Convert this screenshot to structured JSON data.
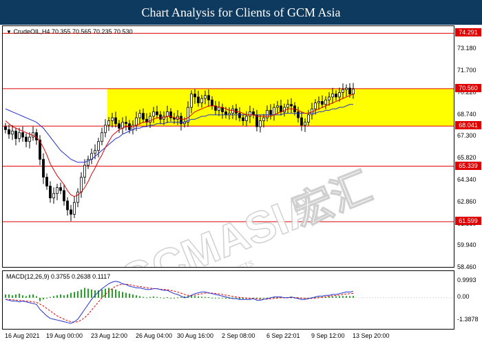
{
  "header": {
    "title": "Chart Analysis for Clients of GCM Asia"
  },
  "main": {
    "symbol_label": "CrudeOIL,H4  70.355 70.565 70.235 70.530",
    "watermark_main": "GCMASIA",
    "watermark_chinese": "宏汇",
    "watermark_sub": "GLOBAL CAPITAL MARKETS"
  },
  "macd": {
    "label": "MACD(12,26,9) 0.3755 0.2638 0.1117"
  },
  "colors": {
    "header_bg": "#0d3a5e",
    "zone_fill": "#ffff00",
    "level_line": "#e00000",
    "ma_fast": "#e00000",
    "ma_slow": "#2030d0",
    "candle": "#000000",
    "macd_hist": "#22a022",
    "macd_signal": "#e00000",
    "macd_line": "#2030d0"
  },
  "chart_data": [
    {
      "type": "candlestick",
      "symbol": "CrudeOIL",
      "timeframe": "H4",
      "ylim": [
        58.46,
        74.77
      ],
      "price_ticks": [
        73.18,
        71.7,
        70.22,
        68.74,
        67.3,
        65.82,
        64.34,
        62.86,
        61.38,
        59.94,
        58.46
      ],
      "price_tick_labels": [
        "73.180",
        "71.700",
        "70.220",
        "68.740",
        "67.300",
        "65.820",
        "64.340",
        "62.860",
        "61.380",
        "59.940",
        "58.460"
      ],
      "x_labels": [
        "16 Aug 2021",
        "19 Aug 00:00",
        "23 Aug 12:00",
        "26 Aug 04:00",
        "30 Aug 16:00",
        "2 Sep 08:00",
        "6 Sep 22:01",
        "9 Sep 12:00",
        "13 Sep 20:00"
      ],
      "x_label_bars": [
        0,
        12,
        25,
        38,
        50,
        63,
        76,
        89,
        101
      ],
      "horizontal_levels": [
        {
          "value": 74.291,
          "label": "74.291"
        },
        {
          "value": 70.56,
          "label": "70.560"
        },
        {
          "value": 68.041,
          "label": "68.041"
        },
        {
          "value": 65.339,
          "label": "65.339"
        },
        {
          "value": 61.599,
          "label": "61.599"
        }
      ],
      "highlight_zone": {
        "from": 68.041,
        "to": 70.56,
        "start_bar": 30,
        "color": "#ffff00"
      },
      "close": [
        67.8,
        67.5,
        67.7,
        67.2,
        67.6,
        67.3,
        67.0,
        67.3,
        67.6,
        67.1,
        65.8,
        64.6,
        64.0,
        63.2,
        63.5,
        63.9,
        63.7,
        63.0,
        62.4,
        62.1,
        62.9,
        63.6,
        64.6,
        65.4,
        65.8,
        66.2,
        66.4,
        67.0,
        67.6,
        68.1,
        68.4,
        68.6,
        68.2,
        67.9,
        68.3,
        68.2,
        67.8,
        68.1,
        68.6,
        68.9,
        68.5,
        68.3,
        68.7,
        69.0,
        68.8,
        68.5,
        68.7,
        69.0,
        68.6,
        68.5,
        68.7,
        68.2,
        68.3,
        69.3,
        70.2,
        70.0,
        69.6,
        69.9,
        70.1,
        69.8,
        69.4,
        69.1,
        69.3,
        69.0,
        68.8,
        68.9,
        69.2,
        68.9,
        68.6,
        68.4,
        68.7,
        69.0,
        68.8,
        68.0,
        68.4,
        68.6,
        69.1,
        68.8,
        69.3,
        69.4,
        69.0,
        69.3,
        69.5,
        69.4,
        69.0,
        68.6,
        68.1,
        68.3,
        68.8,
        69.2,
        69.6,
        69.7,
        69.5,
        69.8,
        70.0,
        70.2,
        70.0,
        70.3,
        70.5,
        70.6,
        70.2,
        70.53
      ],
      "ma_fast": [
        68.4,
        68.2,
        68.0,
        67.9,
        67.8,
        67.7,
        67.6,
        67.5,
        67.4,
        67.3,
        67.0,
        66.6,
        66.1,
        65.5,
        65.1,
        64.7,
        64.4,
        64.1,
        63.7,
        63.4,
        63.3,
        63.4,
        63.6,
        63.9,
        64.3,
        64.8,
        65.2,
        65.7,
        66.1,
        66.6,
        67.0,
        67.4,
        67.6,
        67.8,
        67.9,
        68.0,
        68.0,
        68.0,
        68.1,
        68.2,
        68.3,
        68.3,
        68.4,
        68.5,
        68.6,
        68.6,
        68.6,
        68.7,
        68.7,
        68.6,
        68.6,
        68.5,
        68.5,
        68.6,
        68.8,
        69.0,
        69.1,
        69.2,
        69.3,
        69.4,
        69.4,
        69.4,
        69.3,
        69.3,
        69.2,
        69.1,
        69.1,
        69.0,
        69.0,
        68.9,
        68.8,
        68.8,
        68.8,
        68.7,
        68.7,
        68.7,
        68.7,
        68.7,
        68.8,
        68.9,
        69.0,
        69.1,
        69.2,
        69.2,
        69.2,
        69.1,
        69.0,
        68.9,
        68.9,
        69.0,
        69.1,
        69.2,
        69.3,
        69.4,
        69.5,
        69.6,
        69.7,
        69.8,
        69.9,
        70.0,
        70.1,
        70.2
      ],
      "ma_slow": [
        69.2,
        69.1,
        69.0,
        68.9,
        68.8,
        68.7,
        68.6,
        68.5,
        68.4,
        68.3,
        68.1,
        67.9,
        67.6,
        67.3,
        67.0,
        66.7,
        66.4,
        66.2,
        66.0,
        65.8,
        65.7,
        65.6,
        65.6,
        65.6,
        65.7,
        65.8,
        66.0,
        66.2,
        66.4,
        66.6,
        66.8,
        67.0,
        67.2,
        67.3,
        67.5,
        67.6,
        67.7,
        67.8,
        67.9,
        67.9,
        68.0,
        68.0,
        68.1,
        68.1,
        68.2,
        68.2,
        68.2,
        68.3,
        68.3,
        68.3,
        68.3,
        68.3,
        68.3,
        68.4,
        68.5,
        68.5,
        68.6,
        68.7,
        68.7,
        68.8,
        68.8,
        68.8,
        68.8,
        68.8,
        68.8,
        68.8,
        68.8,
        68.8,
        68.8,
        68.8,
        68.8,
        68.8,
        68.8,
        68.8,
        68.8,
        68.8,
        68.8,
        68.8,
        68.8,
        68.8,
        68.8,
        68.9,
        68.9,
        68.9,
        68.9,
        68.9,
        68.9,
        68.9,
        68.9,
        68.9,
        68.9,
        69.0,
        69.0,
        69.1,
        69.1,
        69.2,
        69.2,
        69.3,
        69.3,
        69.4,
        69.5,
        69.5
      ]
    },
    {
      "type": "macd",
      "ylim": [
        -1.8,
        1.2
      ],
      "tick_labels": [
        "0.9993",
        "0.00",
        "-1.3878"
      ],
      "tick_values": [
        0.9993,
        0.0,
        -1.3878
      ],
      "histogram": [
        0.2,
        0.2,
        0.15,
        0.2,
        0.25,
        0.15,
        0.1,
        0.18,
        0.2,
        0.1,
        -0.2,
        -0.1,
        0.0,
        0.05,
        0.1,
        0.15,
        0.2,
        0.15,
        0.2,
        0.3,
        0.35,
        0.4,
        0.5,
        0.6,
        0.55,
        0.5,
        0.45,
        0.45,
        0.5,
        0.55,
        0.6,
        0.55,
        0.5,
        0.4,
        0.35,
        0.3,
        0.25,
        0.2,
        0.15,
        0.1,
        0.05,
        0.02,
        0.05,
        0.08,
        0.05,
        0.02,
        0.0,
        0.03,
        0.0,
        0.0,
        0.02,
        0.05,
        0.08,
        0.1,
        0.12,
        0.1,
        0.08,
        0.06,
        0.05,
        0.03,
        0.0,
        -0.02,
        -0.03,
        -0.04,
        -0.05,
        -0.06,
        -0.06,
        -0.07,
        -0.08,
        -0.07,
        -0.06,
        -0.05,
        -0.04,
        -0.06,
        -0.05,
        -0.03,
        0.0,
        0.02,
        0.03,
        0.04,
        0.03,
        0.02,
        0.03,
        0.02,
        0.0,
        -0.02,
        -0.04,
        -0.02,
        0.0,
        0.02,
        0.04,
        0.05,
        0.06,
        0.07,
        0.08,
        0.08,
        0.09,
        0.1,
        0.1,
        0.11,
        0.1,
        0.11
      ],
      "macd_line": [
        -0.1,
        -0.15,
        -0.2,
        -0.2,
        -0.25,
        -0.2,
        -0.25,
        -0.3,
        -0.35,
        -0.4,
        -0.7,
        -0.9,
        -1.1,
        -1.25,
        -1.3,
        -1.35,
        -1.4,
        -1.45,
        -1.5,
        -1.55,
        -1.45,
        -1.3,
        -1.0,
        -0.7,
        -0.4,
        -0.1,
        0.15,
        0.35,
        0.55,
        0.7,
        0.85,
        0.95,
        1.0,
        0.95,
        0.85,
        0.8,
        0.7,
        0.65,
        0.6,
        0.6,
        0.55,
        0.5,
        0.5,
        0.55,
        0.55,
        0.5,
        0.45,
        0.45,
        0.35,
        0.25,
        0.2,
        0.1,
        0.0,
        0.05,
        0.15,
        0.25,
        0.3,
        0.35,
        0.35,
        0.3,
        0.25,
        0.2,
        0.15,
        0.1,
        0.05,
        0.0,
        -0.05,
        -0.05,
        -0.1,
        -0.1,
        -0.1,
        -0.1,
        -0.05,
        -0.15,
        -0.15,
        -0.1,
        -0.05,
        0.0,
        0.05,
        0.05,
        0.05,
        0.0,
        0.0,
        0.05,
        0.0,
        -0.05,
        -0.1,
        -0.1,
        -0.05,
        0.0,
        0.05,
        0.1,
        0.1,
        0.15,
        0.15,
        0.2,
        0.2,
        0.25,
        0.3,
        0.35,
        0.35,
        0.38
      ],
      "signal_line": [
        -0.1,
        -0.1,
        -0.12,
        -0.14,
        -0.16,
        -0.18,
        -0.2,
        -0.22,
        -0.25,
        -0.28,
        -0.38,
        -0.5,
        -0.65,
        -0.8,
        -0.95,
        -1.1,
        -1.2,
        -1.3,
        -1.38,
        -1.45,
        -1.48,
        -1.45,
        -1.35,
        -1.2,
        -1.0,
        -0.75,
        -0.5,
        -0.25,
        0.0,
        0.2,
        0.4,
        0.55,
        0.7,
        0.78,
        0.82,
        0.82,
        0.8,
        0.75,
        0.7,
        0.68,
        0.65,
        0.6,
        0.58,
        0.56,
        0.55,
        0.52,
        0.5,
        0.48,
        0.45,
        0.4,
        0.35,
        0.28,
        0.2,
        0.15,
        0.14,
        0.16,
        0.2,
        0.24,
        0.28,
        0.29,
        0.28,
        0.26,
        0.23,
        0.2,
        0.16,
        0.12,
        0.08,
        0.05,
        0.02,
        0.0,
        -0.02,
        -0.04,
        -0.04,
        -0.06,
        -0.08,
        -0.09,
        -0.08,
        -0.06,
        -0.04,
        -0.02,
        0.0,
        0.0,
        0.0,
        0.01,
        0.01,
        0.0,
        -0.02,
        -0.04,
        -0.04,
        -0.04,
        -0.02,
        0.0,
        0.03,
        0.06,
        0.09,
        0.12,
        0.14,
        0.17,
        0.2,
        0.23,
        0.25,
        0.27
      ]
    }
  ]
}
